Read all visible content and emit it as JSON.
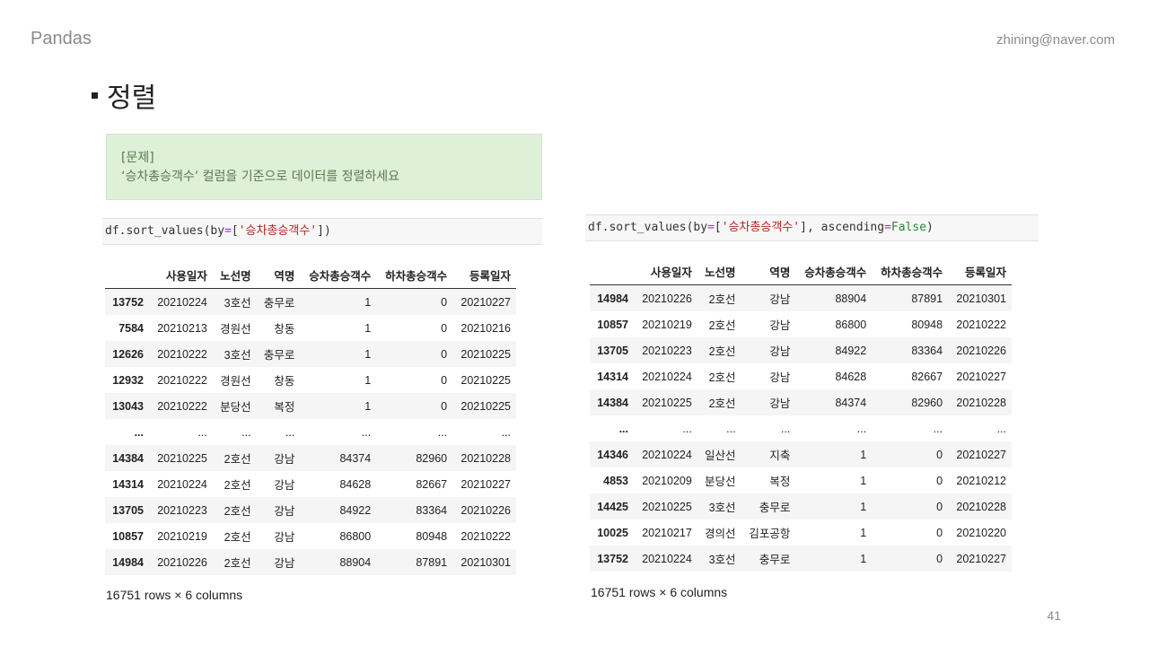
{
  "header": {
    "section": "Pandas",
    "email": "zhining@naver.com"
  },
  "title": "정렬",
  "problem": {
    "label": "[문제]",
    "text": "‘승차총승객수’ 컬럼을 기준으로 데이터를 정렬하세요"
  },
  "left": {
    "code": {
      "prefix": "df.sort_values(by",
      "eq": "=",
      "open": "[",
      "str": "'승차총승객수'",
      "close": "])"
    },
    "columns": [
      "",
      "사용일자",
      "노선명",
      "역명",
      "승차총승객수",
      "하차총승객수",
      "등록일자"
    ],
    "rows": [
      [
        "13752",
        "20210224",
        "3호선",
        "충무로",
        "1",
        "0",
        "20210227"
      ],
      [
        "7584",
        "20210213",
        "경원선",
        "창동",
        "1",
        "0",
        "20210216"
      ],
      [
        "12626",
        "20210222",
        "3호선",
        "충무로",
        "1",
        "0",
        "20210225"
      ],
      [
        "12932",
        "20210222",
        "경원선",
        "창동",
        "1",
        "0",
        "20210225"
      ],
      [
        "13043",
        "20210222",
        "분당선",
        "복정",
        "1",
        "0",
        "20210225"
      ],
      [
        "...",
        "...",
        "...",
        "...",
        "...",
        "...",
        "..."
      ],
      [
        "14384",
        "20210225",
        "2호선",
        "강남",
        "84374",
        "82960",
        "20210228"
      ],
      [
        "14314",
        "20210224",
        "2호선",
        "강남",
        "84628",
        "82667",
        "20210227"
      ],
      [
        "13705",
        "20210223",
        "2호선",
        "강남",
        "84922",
        "83364",
        "20210226"
      ],
      [
        "10857",
        "20210219",
        "2호선",
        "강남",
        "86800",
        "80948",
        "20210222"
      ],
      [
        "14984",
        "20210226",
        "2호선",
        "강남",
        "88904",
        "87891",
        "20210301"
      ]
    ],
    "shape": "16751 rows × 6 columns"
  },
  "right": {
    "code": {
      "prefix": "df.sort_values(by",
      "eq": "=",
      "open": "[",
      "str": "'승차총승객수'",
      "mid": "], ascending",
      "eq2": "=",
      "kw": "False",
      "close": ")"
    },
    "columns": [
      "",
      "사용일자",
      "노선명",
      "역명",
      "승차총승객수",
      "하차총승객수",
      "등록일자"
    ],
    "rows": [
      [
        "14984",
        "20210226",
        "2호선",
        "강남",
        "88904",
        "87891",
        "20210301"
      ],
      [
        "10857",
        "20210219",
        "2호선",
        "강남",
        "86800",
        "80948",
        "20210222"
      ],
      [
        "13705",
        "20210223",
        "2호선",
        "강남",
        "84922",
        "83364",
        "20210226"
      ],
      [
        "14314",
        "20210224",
        "2호선",
        "강남",
        "84628",
        "82667",
        "20210227"
      ],
      [
        "14384",
        "20210225",
        "2호선",
        "강남",
        "84374",
        "82960",
        "20210228"
      ],
      [
        "...",
        "...",
        "...",
        "...",
        "...",
        "...",
        "..."
      ],
      [
        "14346",
        "20210224",
        "일산선",
        "지축",
        "1",
        "0",
        "20210227"
      ],
      [
        "4853",
        "20210209",
        "분당선",
        "복정",
        "1",
        "0",
        "20210212"
      ],
      [
        "14425",
        "20210225",
        "3호선",
        "충무로",
        "1",
        "0",
        "20210228"
      ],
      [
        "10025",
        "20210217",
        "경의선",
        "김포공항",
        "1",
        "0",
        "20210220"
      ],
      [
        "13752",
        "20210224",
        "3호선",
        "충무로",
        "1",
        "0",
        "20210227"
      ]
    ],
    "shape": "16751 rows × 6 columns"
  },
  "page_number": "41"
}
